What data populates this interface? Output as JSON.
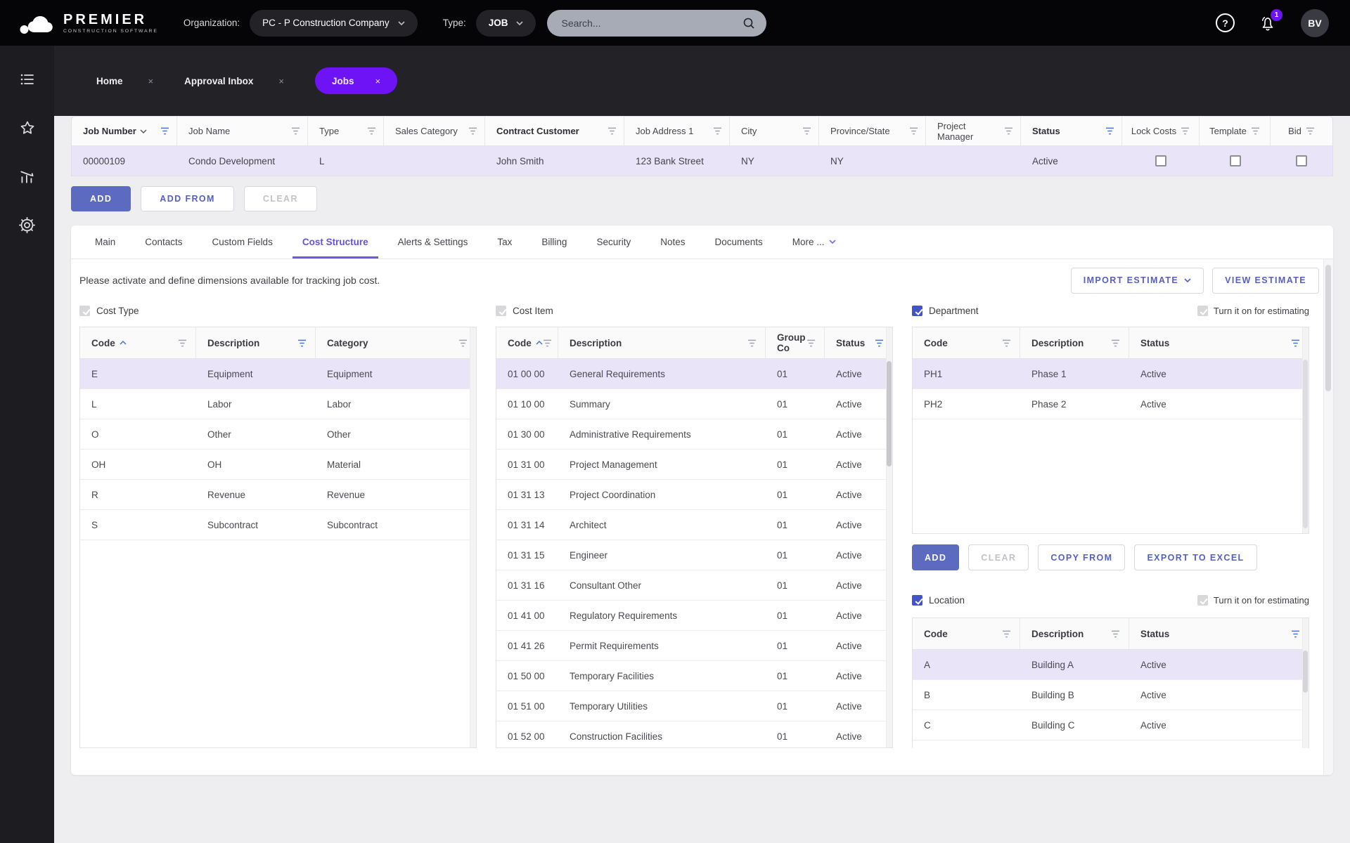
{
  "colors": {
    "accent": "#6d13f5",
    "indigo": "#5c6bc0",
    "selrow": "#e9e4f8",
    "fblue": "#4a74d8",
    "tabactive": "#6554d8"
  },
  "glyphs": {
    "close": "×",
    "help": "?"
  },
  "header": {
    "brand": "PREMIER",
    "brand_tagline": "CONSTRUCTION SOFTWARE",
    "organization_label": "Organization:",
    "organization_value": "PC - P Construction Company",
    "type_label": "Type:",
    "type_value": "JOB",
    "search_placeholder": "Search...",
    "notification_count": "1",
    "avatar_initials": "BV"
  },
  "workspace_tabs": {
    "home": "Home",
    "approval_inbox": "Approval Inbox",
    "jobs": "Jobs"
  },
  "jobs_grid": {
    "columns": [
      "Job Number",
      "Job Name",
      "Type",
      "Sales Category",
      "Contract Customer",
      "Job Address 1",
      "City",
      "Province/State",
      "Project Manager",
      "Status",
      "Lock Costs",
      "Template",
      "Bid"
    ],
    "row": {
      "job_number": "00000109",
      "job_name": "Condo Development",
      "type": "L",
      "sales_category": "",
      "contract_customer": "John Smith",
      "job_address_1": "123 Bank Street",
      "city": "NY",
      "province_state": "NY",
      "project_manager": "",
      "status": "Active"
    }
  },
  "grid_actions": {
    "add": "ADD",
    "add_from": "ADD FROM",
    "clear": "CLEAR"
  },
  "detail_tabs": [
    "Main",
    "Contacts",
    "Custom Fields",
    "Cost Structure",
    "Alerts & Settings",
    "Tax",
    "Billing",
    "Security",
    "Notes",
    "Documents",
    "More ..."
  ],
  "cost_structure": {
    "description": "Please activate and define dimensions available for tracking job cost.",
    "import_estimate_label": "IMPORT ESTIMATE",
    "view_estimate_label": "VIEW ESTIMATE",
    "cost_type": {
      "label": "Cost Type",
      "columns": [
        "Code",
        "Description",
        "Category"
      ],
      "rows": [
        [
          "E",
          "Equipment",
          "Equipment"
        ],
        [
          "L",
          "Labor",
          "Labor"
        ],
        [
          "O",
          "Other",
          "Other"
        ],
        [
          "OH",
          "OH",
          "Material"
        ],
        [
          "R",
          "Revenue",
          "Revenue"
        ],
        [
          "S",
          "Subcontract",
          "Subcontract"
        ]
      ]
    },
    "cost_item": {
      "label": "Cost Item",
      "columns": [
        "Code",
        "Description",
        "Group Co",
        "Status"
      ],
      "rows": [
        [
          "01 00 00",
          "General Requirements",
          "01",
          "Active"
        ],
        [
          "01 10 00",
          "Summary",
          "01",
          "Active"
        ],
        [
          "01 30 00",
          "Administrative Requirements",
          "01",
          "Active"
        ],
        [
          "01 31 00",
          "Project Management",
          "01",
          "Active"
        ],
        [
          "01 31 13",
          "Project Coordination",
          "01",
          "Active"
        ],
        [
          "01 31 14",
          "Architect",
          "01",
          "Active"
        ],
        [
          "01 31 15",
          "Engineer",
          "01",
          "Active"
        ],
        [
          "01 31 16",
          "Consultant Other",
          "01",
          "Active"
        ],
        [
          "01 41 00",
          "Regulatory Requirements",
          "01",
          "Active"
        ],
        [
          "01 41 26",
          "Permit Requirements",
          "01",
          "Active"
        ],
        [
          "01 50 00",
          "Temporary Facilities",
          "01",
          "Active"
        ],
        [
          "01 51 00",
          "Temporary Utilities",
          "01",
          "Active"
        ],
        [
          "01 52 00",
          "Construction Facilities",
          "01",
          "Active"
        ]
      ]
    },
    "department": {
      "label": "Department",
      "estimating_label": "Turn it on for estimating",
      "columns": [
        "Code",
        "Description",
        "Status"
      ],
      "rows": [
        [
          "PH1",
          "Phase 1",
          "Active"
        ],
        [
          "PH2",
          "Phase 2",
          "Active"
        ]
      ],
      "actions": {
        "add": "ADD",
        "clear": "CLEAR",
        "copy_from": "COPY FROM",
        "export_excel": "EXPORT TO EXCEL"
      }
    },
    "location": {
      "label": "Location",
      "estimating_label": "Turn it on for estimating",
      "columns": [
        "Code",
        "Description",
        "Status"
      ],
      "rows": [
        [
          "A",
          "Building A",
          "Active"
        ],
        [
          "B",
          "Building B",
          "Active"
        ],
        [
          "C",
          "Building C",
          "Active"
        ]
      ]
    }
  }
}
